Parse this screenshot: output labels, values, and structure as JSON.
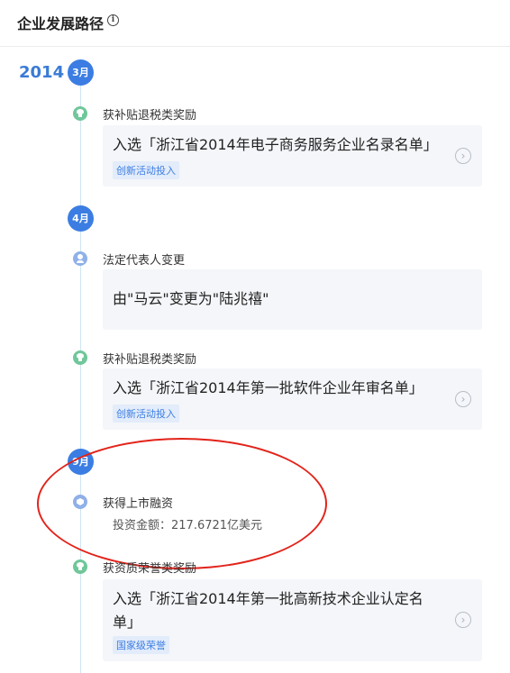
{
  "header": {
    "title": "企业发展路径",
    "info_icon": "i"
  },
  "timeline": {
    "year": "2014",
    "months": [
      "3月",
      "4月",
      "9月"
    ],
    "events": [
      {
        "label": "获补贴退税类奖励",
        "icon": "award-icon",
        "card_text": "入选「浙江省2014年电子商务服务企业名录名单」",
        "tag": "创新活动投入"
      },
      {
        "label": "法定代表人变更",
        "icon": "person-icon",
        "card_text": "由\"马云\"变更为\"陆兆禧\""
      },
      {
        "label": "获补贴退税类奖励",
        "icon": "award-icon",
        "card_text": "入选「浙江省2014年第一批软件企业年审名单」",
        "tag": "创新活动投入"
      },
      {
        "label": "获得上市融资",
        "icon": "finance-icon",
        "detail": "投资金额：217.6721亿美元"
      },
      {
        "label": "获资质荣誉类奖励",
        "icon": "award-icon",
        "card_text": "入选「浙江省2014年第一批高新技术企业认定名单」",
        "tag": "国家级荣誉"
      }
    ]
  },
  "arrow_glyph": "›",
  "colors": {
    "accent": "#3b7de2",
    "award_green": "#6fc79a",
    "annotation_red": "#e2231a"
  }
}
